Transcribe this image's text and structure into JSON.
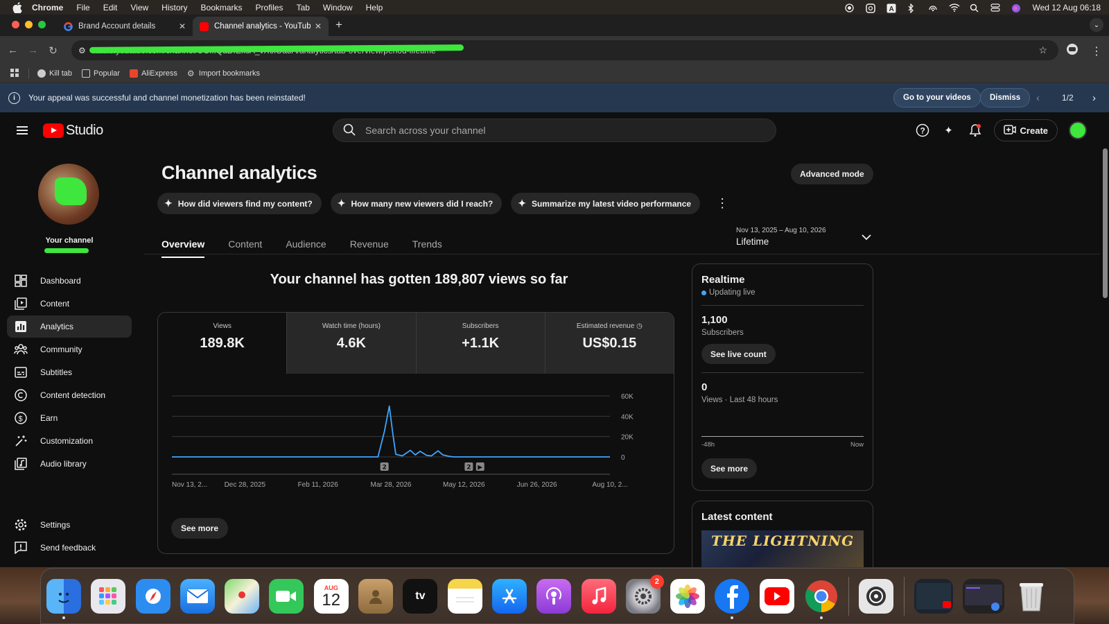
{
  "menubar": {
    "app": "Chrome",
    "items": [
      "File",
      "Edit",
      "View",
      "History",
      "Bookmarks",
      "Profiles",
      "Tab",
      "Window",
      "Help"
    ],
    "datetime": "Wed 12 Aug  06:18"
  },
  "browser": {
    "tabs": [
      {
        "title": "Brand Account details"
      },
      {
        "title": "Channel analytics - YouTube S"
      }
    ],
    "url": "studio.youtube.com/channel/UC...QaDfEkcA_vX6iOa5A/analytics/tab-overview/period-lifetime",
    "bookmarks": [
      "Kill tab",
      "Popular",
      "AliExpress",
      "Import bookmarks"
    ]
  },
  "banner": {
    "message": "Your appeal was successful and channel monetization has been reinstated!",
    "go_label": "Go to your videos",
    "dismiss_label": "Dismiss",
    "pager": "1/2"
  },
  "header": {
    "logo_text": "Studio",
    "search_placeholder": "Search across your channel",
    "create_label": "Create"
  },
  "sidebar": {
    "channel_label": "Your channel",
    "items": [
      {
        "label": "Dashboard",
        "icon": "dashboard-icon"
      },
      {
        "label": "Content",
        "icon": "content-icon"
      },
      {
        "label": "Analytics",
        "icon": "analytics-icon"
      },
      {
        "label": "Community",
        "icon": "community-icon"
      },
      {
        "label": "Subtitles",
        "icon": "subtitles-icon"
      },
      {
        "label": "Content detection",
        "icon": "copyright-icon"
      },
      {
        "label": "Earn",
        "icon": "dollar-icon"
      },
      {
        "label": "Customization",
        "icon": "magic-wand-icon"
      },
      {
        "label": "Audio library",
        "icon": "audio-library-icon"
      },
      {
        "label": "Settings",
        "icon": "gear-icon"
      },
      {
        "label": "Send feedback",
        "icon": "feedback-icon"
      }
    ]
  },
  "main": {
    "title": "Channel analytics",
    "advanced_mode": "Advanced mode",
    "chips": [
      "How did viewers find my content?",
      "How many new viewers did I reach?",
      "Summarize my latest video performance"
    ],
    "tabs": [
      "Overview",
      "Content",
      "Audience",
      "Revenue",
      "Trends"
    ],
    "date_range": {
      "range": "Nov 13, 2025 – Aug 10, 2026",
      "period": "Lifetime"
    },
    "headline": "Your channel has gotten 189,807 views so far",
    "metrics": [
      {
        "label": "Views",
        "value": "189.8K"
      },
      {
        "label": "Watch time (hours)",
        "value": "4.6K"
      },
      {
        "label": "Subscribers",
        "value": "+1.1K"
      },
      {
        "label": "Estimated revenue",
        "value": "US$0.15"
      }
    ],
    "see_more": "See more"
  },
  "chart_data": {
    "type": "line",
    "x_labels": [
      "Nov 13, 2...",
      "Dec 28, 2025",
      "Feb 11, 2026",
      "Mar 28, 2026",
      "May 12, 2026",
      "Jun 26, 2026",
      "Aug 10, 2..."
    ],
    "y_ticks": [
      "60K",
      "40K",
      "20K",
      "0"
    ],
    "ylim": [
      0,
      60000
    ],
    "series": [
      {
        "color": "#3ea6ff",
        "x": [
          "2025-11-13",
          "2026-03-05",
          "2026-03-20",
          "2026-03-24",
          "2026-03-27",
          "2026-03-29",
          "2026-03-31",
          "2026-04-04",
          "2026-04-09",
          "2026-04-12",
          "2026-04-15",
          "2026-04-19",
          "2026-04-22",
          "2026-04-26",
          "2026-04-29",
          "2026-05-03",
          "2026-05-06",
          "2026-05-09",
          "2026-08-10"
        ],
        "y": [
          0,
          0,
          0,
          25000,
          50000,
          25000,
          2500,
          1000,
          6500,
          2000,
          5500,
          1500,
          1000,
          6000,
          2000,
          500,
          0,
          0,
          0
        ]
      }
    ],
    "markers": [
      {
        "x": "2026-03-24",
        "label": "2"
      },
      {
        "x": "2026-05-15",
        "label": "2"
      },
      {
        "x": "2026-05-22",
        "label": "▶"
      }
    ],
    "grid": true
  },
  "realtime": {
    "title": "Realtime",
    "status": "Updating live",
    "subscribers_value": "1,100",
    "subscribers_label": "Subscribers",
    "live_count_label": "See live count",
    "views_value": "0",
    "views_label": "Views · Last 48 hours",
    "axis_start": "-48h",
    "axis_end": "Now",
    "see_more": "See more"
  },
  "latest": {
    "title": "Latest content",
    "thumb_text": "THE LIGHTNING"
  },
  "dock": {
    "calendar_month": "AUG",
    "calendar_day": "12",
    "settings_badge": "2",
    "tv_label": "tv"
  }
}
